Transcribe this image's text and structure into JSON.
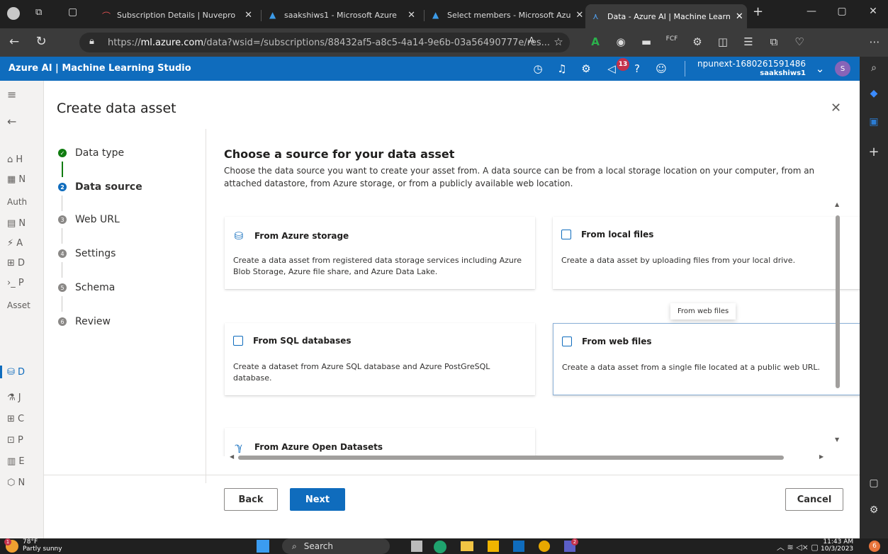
{
  "browser": {
    "tabs": [
      {
        "label": "Subscription Details | Nuvepro",
        "active": false
      },
      {
        "label": "saakshiws1 - Microsoft Azure",
        "active": false
      },
      {
        "label": "Select members - Microsoft Azu",
        "active": false
      },
      {
        "label": "Data - Azure AI | Machine Learn",
        "active": true
      }
    ],
    "url_prefix": "https://",
    "url_host": "ml.azure.com",
    "url_rest": "/data?wsid=/subscriptions/88432af5-a8c5-4a14-9e6b-03a56490777e/res..."
  },
  "app_header": {
    "title": "Azure AI | Machine Learning Studio",
    "notification_count": "13",
    "workspace_name": "npunext-1680261591486",
    "workspace_sub": "saakshiws1",
    "avatar_initial": "S"
  },
  "left_nav": {
    "items": [
      "H",
      "N",
      "Auth",
      "N",
      "A",
      "D",
      "P",
      "Asset",
      "D",
      "J",
      "C",
      "P",
      "E",
      "N"
    ]
  },
  "dialog": {
    "title": "Create data asset",
    "steps": [
      {
        "num": "✓",
        "label": "Data type",
        "state": "done"
      },
      {
        "num": "2",
        "label": "Data source",
        "state": "current"
      },
      {
        "num": "3",
        "label": "Web URL",
        "state": "pending"
      },
      {
        "num": "4",
        "label": "Settings",
        "state": "pending"
      },
      {
        "num": "5",
        "label": "Schema",
        "state": "pending"
      },
      {
        "num": "6",
        "label": "Review",
        "state": "pending"
      }
    ],
    "heading": "Choose a source for your data asset",
    "description": "Choose the data source you want to create your asset from. A data source can be from a local storage location on your computer, from an attached datastore, from Azure storage, or from a publicly available web location.",
    "cards": [
      {
        "title": "From Azure storage",
        "desc": "Create a data asset from registered data storage services including Azure Blob Storage, Azure file share, and Azure Data Lake.",
        "icon": "storage-icon"
      },
      {
        "title": "From local files",
        "desc": "Create a data asset by uploading files from your local drive.",
        "icon": "file-icon"
      },
      {
        "title": "From SQL databases",
        "desc": "Create a dataset from Azure SQL database and Azure PostGreSQL database.",
        "icon": "database-icon"
      },
      {
        "title": "From web files",
        "desc": "Create a data asset from a single file located at a public web URL.",
        "icon": "file-icon"
      },
      {
        "title": "From Azure Open Datasets",
        "desc": "",
        "icon": "branch-icon"
      }
    ],
    "tooltip": "From web files",
    "back_label": "Back",
    "next_label": "Next",
    "cancel_label": "Cancel"
  },
  "taskbar": {
    "weather_temp": "78°F",
    "weather_desc": "Partly sunny",
    "weather_badge": "1",
    "search_label": "Search",
    "teams_badge": "2",
    "time": "11:43 AM",
    "date": "10/3/2023",
    "notif_count": "6"
  },
  "colors": {
    "accent": "#0f6cbd",
    "success": "#107c10",
    "badge": "#c4314b"
  }
}
